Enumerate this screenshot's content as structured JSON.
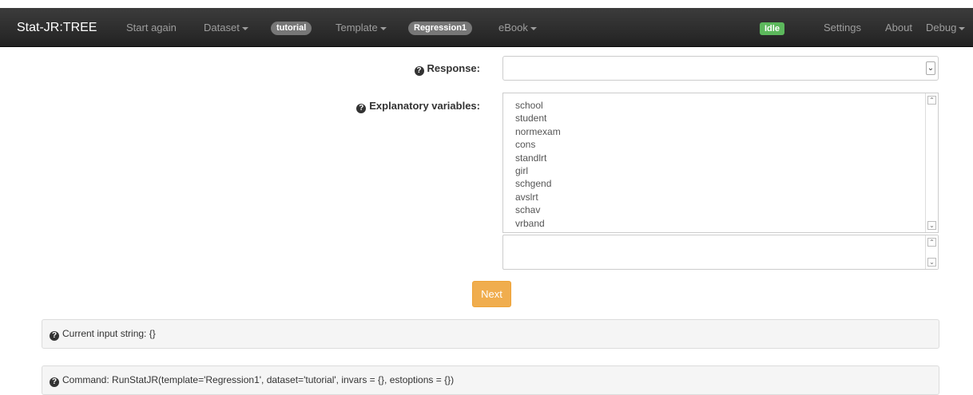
{
  "navbar": {
    "brand": "Stat-JR:TREE",
    "start_again": "Start again",
    "dataset": "Dataset",
    "dataset_badge": "tutorial",
    "template": "Template",
    "template_badge": "Regression1",
    "ebook": "eBook",
    "status": "Idle",
    "settings": "Settings",
    "about": "About",
    "debug": "Debug"
  },
  "form": {
    "response_label": "Response:",
    "response_value": "",
    "explanatory_label": "Explanatory variables:",
    "variables": [
      "school",
      "student",
      "normexam",
      "cons",
      "standlrt",
      "girl",
      "schgend",
      "avslrt",
      "schav",
      "vrband"
    ],
    "next_label": "Next"
  },
  "panels": {
    "input_string": "Current input string: {}",
    "command": "Command: RunStatJR(template='Regression1', dataset='tutorial', invars = {}, estoptions = {})"
  },
  "icons": {
    "help": "question-circle-icon",
    "dropdown": "chevron-down-icon"
  },
  "colors": {
    "navbar": "#222222",
    "badge": "#777777",
    "idle": "#5cb85c",
    "next": "#f0ad4e"
  }
}
